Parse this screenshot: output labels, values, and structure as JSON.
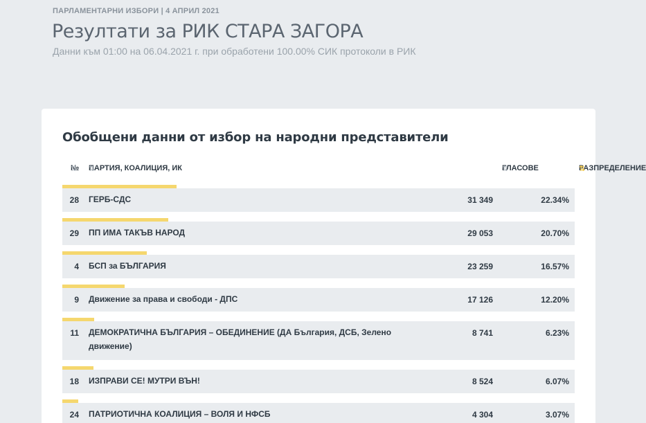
{
  "header": {
    "eyebrow": "ПАРЛАМЕНТАРНИ ИЗБОРИ | 4 АПРИЛ 2021",
    "title": "Резултати за РИК СТАРА ЗАГОРА",
    "subtitle": "Данни към 01:00 на 06.04.2021 г. при обработени 100.00% СИК протоколи в РИК"
  },
  "card": {
    "title": "Обобщени данни от избор на народни представители"
  },
  "table": {
    "columns": {
      "num": "№",
      "party": "ПАРТИЯ, КОАЛИЦИЯ, ИК",
      "votes": "ГЛАСОВЕ",
      "distribution": "РАЗПРЕДЕЛЕНИЕ"
    },
    "sort_icon": "⇅",
    "sort_active_icon": "↓",
    "accent_color": "#f5d76e",
    "rows": [
      {
        "num": "28",
        "party": "ГЕРБ-СДС",
        "votes": "31 349",
        "pct": "22.34%",
        "share": 22.34
      },
      {
        "num": "29",
        "party": "ПП ИМА ТАКЪВ НАРОД",
        "votes": "29 053",
        "pct": "20.70%",
        "share": 20.7
      },
      {
        "num": "4",
        "party": "БСП за БЪЛГАРИЯ",
        "votes": "23 259",
        "pct": "16.57%",
        "share": 16.57
      },
      {
        "num": "9",
        "party": "Движение за права и свободи - ДПС",
        "votes": "17 126",
        "pct": "12.20%",
        "share": 12.2
      },
      {
        "num": "11",
        "party": "ДЕМОКРАТИЧНА БЪЛГАРИЯ – ОБЕДИНЕНИЕ (ДА България, ДСБ, Зелено движение)",
        "votes": "8 741",
        "pct": "6.23%",
        "share": 6.23
      },
      {
        "num": "18",
        "party": "ИЗПРАВИ СЕ! МУТРИ ВЪН!",
        "votes": "8 524",
        "pct": "6.07%",
        "share": 6.07
      },
      {
        "num": "24",
        "party": "ПАТРИОТИЧНА КОАЛИЦИЯ – ВОЛЯ И НФСБ",
        "votes": "4 304",
        "pct": "3.07%",
        "share": 3.07
      }
    ]
  }
}
